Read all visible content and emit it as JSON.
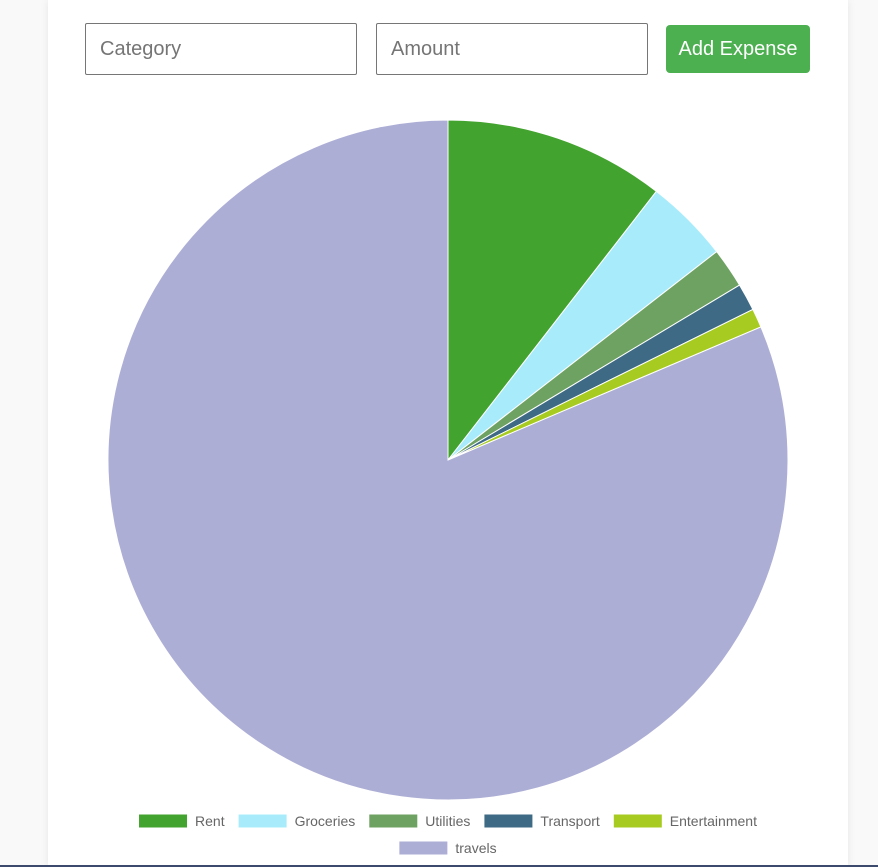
{
  "form": {
    "category_placeholder": "Category",
    "amount_placeholder": "Amount",
    "add_button_label": "Add Expense",
    "button_color": "#4caf50"
  },
  "chart_data": {
    "type": "pie",
    "categories": [
      "Rent",
      "Groceries",
      "Utilities",
      "Transport",
      "Entertainment",
      "travels"
    ],
    "values": [
      10.5,
      4.0,
      1.9,
      1.3,
      0.9,
      81.4
    ],
    "colors": [
      "#43a32f",
      "#a8ecfb",
      "#6ea262",
      "#3e6a85",
      "#a7cb21",
      "#adaed5"
    ],
    "legend_placement": "bottom"
  }
}
